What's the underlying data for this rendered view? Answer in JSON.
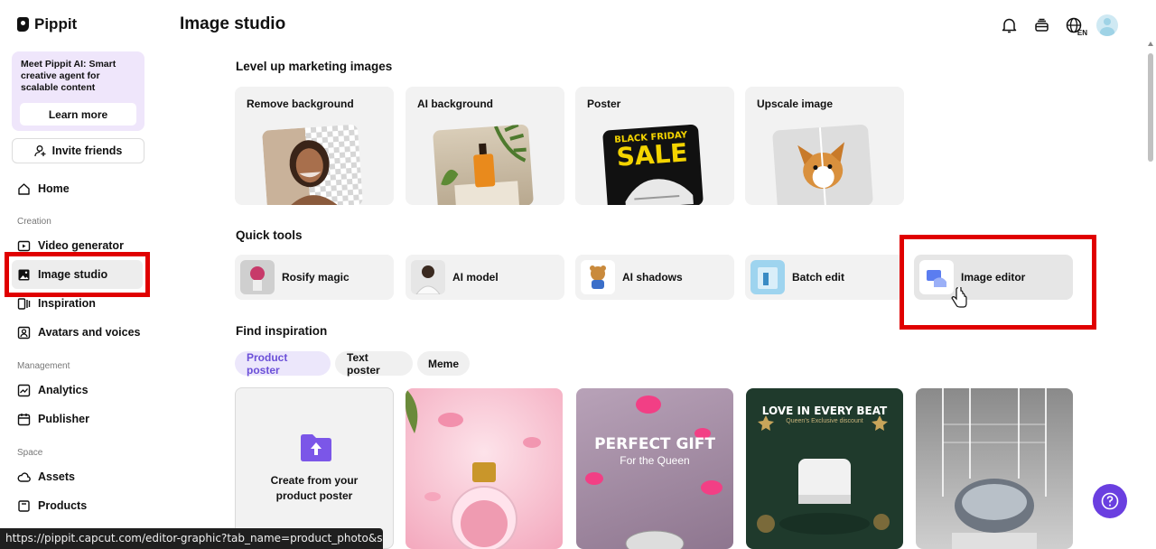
{
  "app": {
    "logo_text": "Pippit"
  },
  "sidebar": {
    "promo_text": "Meet Pippit AI: Smart creative agent for scalable content",
    "promo_button": "Learn more",
    "invite_label": "Invite friends",
    "home": "Home",
    "section_creation": "Creation",
    "creation_items": [
      "Video generator",
      "Image studio",
      "Inspiration",
      "Avatars and voices"
    ],
    "section_management": "Management",
    "management_items": [
      "Analytics",
      "Publisher"
    ],
    "section_space": "Space",
    "space_items": [
      "Assets",
      "Products"
    ],
    "active_item": "Image studio"
  },
  "header": {
    "title": "Image studio",
    "icons": [
      "bell-icon",
      "stack-icon",
      "globe-icon",
      "avatar"
    ],
    "lang_badge": "EN"
  },
  "marketing": {
    "title": "Level up marketing images",
    "cards": [
      "Remove background",
      "AI background",
      "Poster",
      "Upscale image"
    ],
    "poster_text_top": "BLACK FRIDAY",
    "poster_text_main": "SALE"
  },
  "quick_tools": {
    "title": "Quick tools",
    "items": [
      "Rosify magic",
      "AI model",
      "AI shadows",
      "Batch edit",
      "Image editor"
    ],
    "highlighted": "Image editor"
  },
  "inspiration": {
    "title": "Find inspiration",
    "chips": [
      "Product poster",
      "Text poster",
      "Meme"
    ],
    "active_chip": "Product poster",
    "create_card_text": "Create from your product poster",
    "card3_title": "PERFECT GIFT",
    "card3_subtitle": "For the Queen",
    "card4_title": "LOVE IN EVERY BEAT",
    "card4_subtitle": "Queen's Exclusive discount"
  },
  "status_bar": {
    "url": "https://pippit.capcut.com/editor-graphic?tab_name=product_photo&sub_ta..."
  },
  "colors": {
    "accent": "#6a3fe0",
    "highlight_red": "#e00000",
    "promo_bg": "#efe6fb"
  }
}
